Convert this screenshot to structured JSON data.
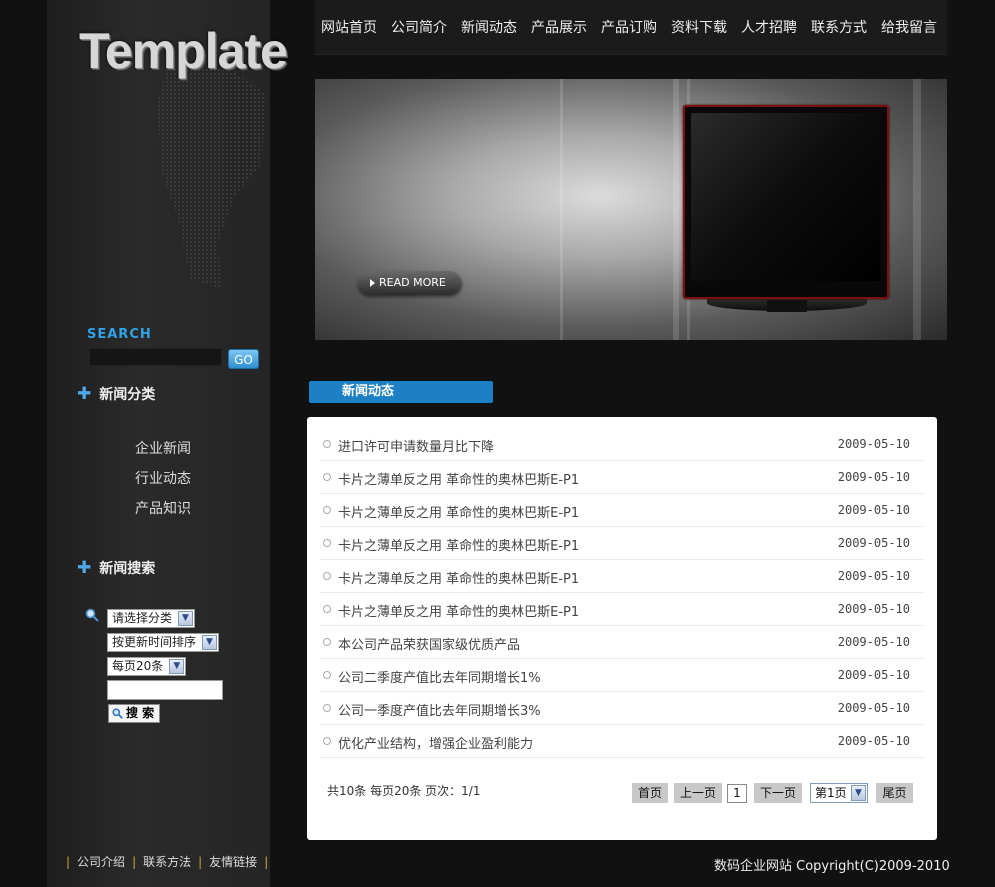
{
  "logo": {
    "text": "Template"
  },
  "nav": {
    "items": [
      "网站首页",
      "公司简介",
      "新闻动态",
      "产品展示",
      "产品订购",
      "资料下载",
      "人才招聘",
      "联系方式",
      "给我留言"
    ]
  },
  "banner": {
    "read_more": "READ MORE"
  },
  "sidebar": {
    "search_label": "SEARCH",
    "go_label": "GO",
    "category_title": "新闻分类",
    "categories": [
      "企业新闻",
      "行业动态",
      "产品知识"
    ],
    "news_search_title": "新闻搜索",
    "category_select": "请选择分类",
    "sort_select": "按更新时间排序",
    "per_page_select": "每页20条",
    "search_button": "搜 索"
  },
  "news": {
    "tab_title": "新闻动态",
    "items": [
      {
        "title": "进口许可申请数量月比下降",
        "date": "2009-05-10"
      },
      {
        "title": "卡片之薄单反之用 革命性的奥林巴斯E-P1",
        "date": "2009-05-10"
      },
      {
        "title": "卡片之薄单反之用 革命性的奥林巴斯E-P1",
        "date": "2009-05-10"
      },
      {
        "title": "卡片之薄单反之用 革命性的奥林巴斯E-P1",
        "date": "2009-05-10"
      },
      {
        "title": "卡片之薄单反之用 革命性的奥林巴斯E-P1",
        "date": "2009-05-10"
      },
      {
        "title": "卡片之薄单反之用 革命性的奥林巴斯E-P1",
        "date": "2009-05-10"
      },
      {
        "title": "本公司产品荣获国家级优质产品",
        "date": "2009-05-10"
      },
      {
        "title": "公司二季度产值比去年同期增长1%",
        "date": "2009-05-10"
      },
      {
        "title": "公司一季度产值比去年同期增长3%",
        "date": "2009-05-10"
      },
      {
        "title": "优化产业结构，增强企业盈利能力",
        "date": "2009-05-10"
      }
    ]
  },
  "pager": {
    "info": "共10条  每页20条  页次：1/1",
    "first": "首页",
    "prev": "上一页",
    "current": "1",
    "next": "下一页",
    "page_select": "第1页",
    "last": "尾页"
  },
  "footer": {
    "links": [
      "公司介绍",
      "联系方法",
      "友情链接"
    ],
    "copyright": "数码企业网站  Copyright(C)2009-2010"
  }
}
